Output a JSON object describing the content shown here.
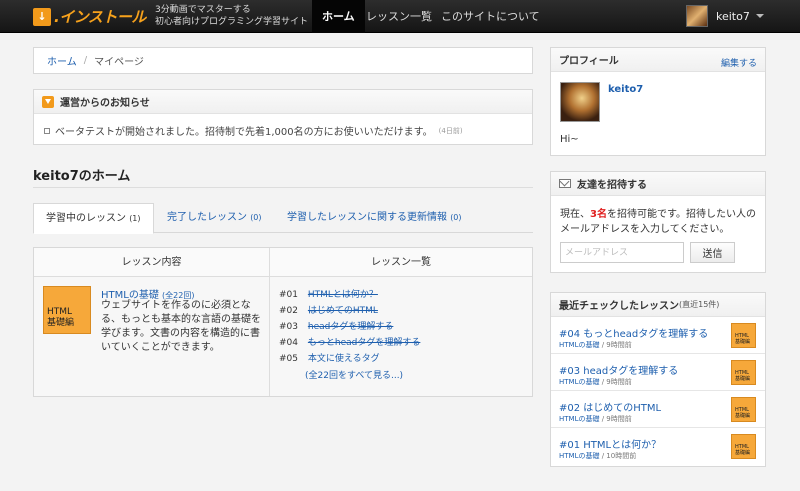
{
  "header": {
    "logo_mark": "↓",
    "logo_text": ".インストール",
    "tagline_line1": "3分動画でマスターする",
    "tagline_line2": "初心者向けプログラミング学習サイト",
    "nav": [
      "ホーム",
      "レッスン一覧",
      "このサイトについて"
    ],
    "username": "keito7"
  },
  "breadcrumb": {
    "home": "ホーム",
    "sep": "/",
    "current": "マイページ"
  },
  "notice": {
    "title": "運営からのお知らせ",
    "message": "ベータテストが開始されました。招待制で先着1,000名の方にお使いいただけます。",
    "ago": "(4日前)"
  },
  "main": {
    "title": "keito7のホーム",
    "tabs": [
      {
        "label": "学習中のレッスン",
        "count": "(1)"
      },
      {
        "label": "完了したレッスン",
        "count": "(0)"
      },
      {
        "label": "学習したレッスンに関する更新情報",
        "count": "(0)"
      }
    ]
  },
  "lesson_table": {
    "col1": "レッスン内容",
    "col2": "レッスン一覧",
    "course": {
      "thumb_line1": "HTML",
      "thumb_line2": "基礎編",
      "name": "HTMLの基礎",
      "count": "(全22回)",
      "description": "ウェブサイトを作るのに必須となる、もっとも基本的な言語の基礎を学びます。文書の内容を構造的に書いていくことができます。"
    },
    "lessons": [
      {
        "num": "#01",
        "title": "HTMLとは何か？",
        "done": true
      },
      {
        "num": "#02",
        "title": "はじめてのHTML",
        "done": true
      },
      {
        "num": "#03",
        "title": "headタグを理解する",
        "done": true
      },
      {
        "num": "#04",
        "title": "もっとheadタグを理解する",
        "done": true
      },
      {
        "num": "#05",
        "title": "本文に使えるタグ",
        "done": false
      }
    ],
    "see_all": "(全22回をすべて見る...)"
  },
  "profile": {
    "title": "プロフィール",
    "edit": "編集する",
    "name": "keito7",
    "bio": "Hi~"
  },
  "invite": {
    "title": "友達を招待する",
    "text_before": "現在、",
    "count": "3名",
    "text_after": "を招待可能です。招待したい人のメールアドレスを入力してください。",
    "placeholder": "メールアドレス",
    "button": "送信"
  },
  "recent": {
    "title": "最近チェックしたレッスン",
    "subtitle": "(直近15件)",
    "items": [
      {
        "title": "#04 もっとheadタグを理解する",
        "course": "HTMLの基礎",
        "ago": "/ 9時間前",
        "thumb1": "HTML",
        "thumb2": "基礎編"
      },
      {
        "title": "#03 headタグを理解する",
        "course": "HTMLの基礎",
        "ago": "/ 9時間前",
        "thumb1": "HTML",
        "thumb2": "基礎編"
      },
      {
        "title": "#02 はじめてのHTML",
        "course": "HTMLの基礎",
        "ago": "/ 9時間前",
        "thumb1": "HTML",
        "thumb2": "基礎編"
      },
      {
        "title": "#01 HTMLとは何か？",
        "course": "HTMLの基礎",
        "ago": "/ 10時間前",
        "thumb1": "HTML",
        "thumb2": "基礎編"
      }
    ]
  }
}
